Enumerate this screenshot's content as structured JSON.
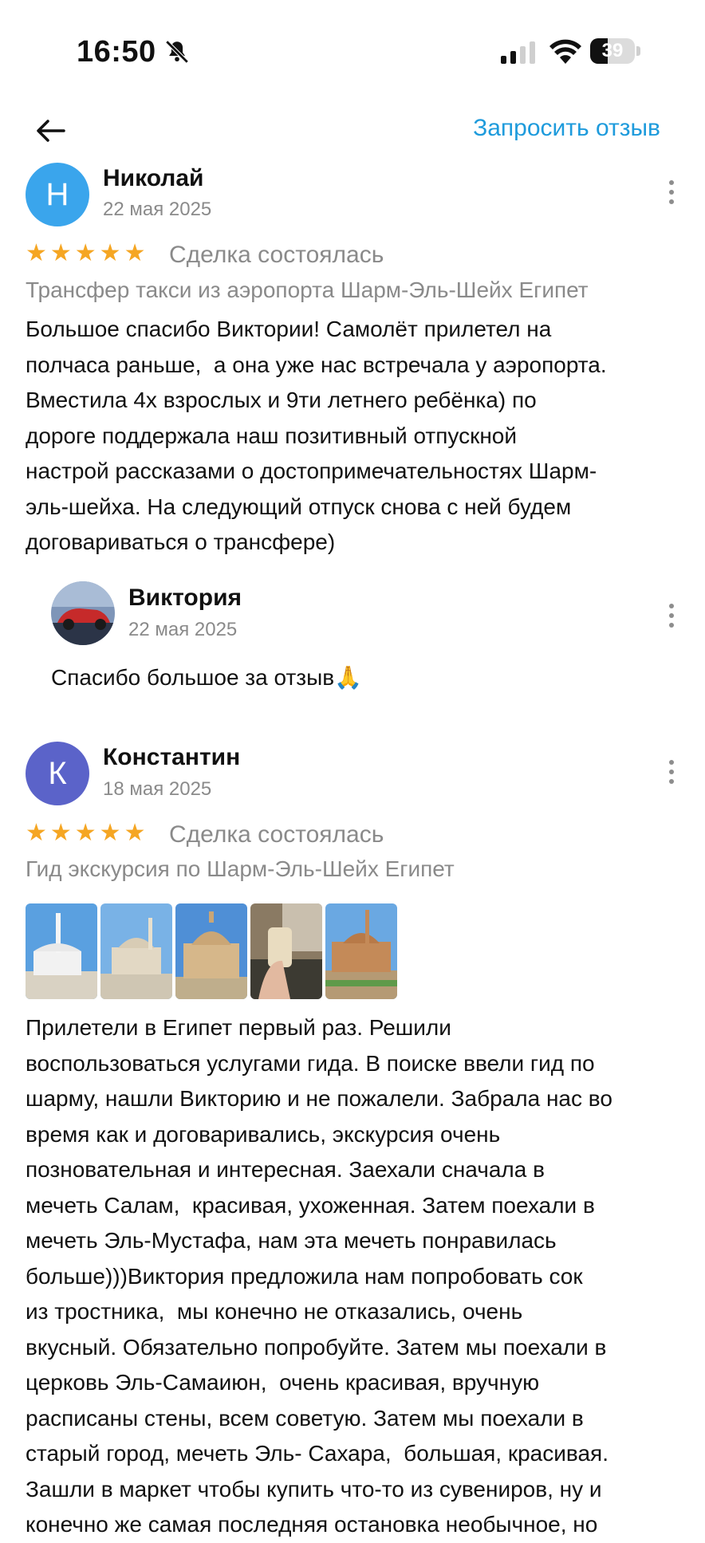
{
  "status_bar": {
    "time": "16:50",
    "battery_level": "39",
    "battery_fraction": 0.39,
    "icons": [
      "bell-muted-icon",
      "signal-icon",
      "wifi-icon",
      "battery-icon"
    ]
  },
  "header": {
    "request_review_label": "Запросить отзыв",
    "accent_color": "#1e9bdc"
  },
  "reviews": [
    {
      "avatar_letter": "Н",
      "avatar_color": "#3aa5ec",
      "name": "Николай",
      "date": "22 мая 2025",
      "rating": 5,
      "stars": "★★★★★",
      "deal_status": "Сделка состоялась",
      "service": "Трансфер такси из аэропорта Шарм-Эль-Шейх Египет",
      "text": "Большое спасибо Виктории! Самолёт прилетел на полчаса раньше,  а она уже нас встречала у аэропорта. Вместила 4х взрослых и 9ти летнего ребёнка) по дороге поддержала наш позитивный отпускной настрой рассказами о достопримечательностях Шарм-эль-шейха. На следующий отпуск снова с ней будем договариваться о трансфере)",
      "lines": [
        "Большое спасибо Виктории! Самолёт прилетел на",
        "полчаса раньше,  а она уже нас встречала у аэропорта.",
        "Вместила 4х взрослых и 9ти летнего ребёнка) по",
        "дороге поддержала наш позитивный отпускной",
        "настрой рассказами о достопримечательностях Шарм-",
        "эль-шейха. На следующий отпуск снова с ней будем",
        "договариваться о трансфере)"
      ],
      "reply": {
        "name": "Виктория",
        "date": "22 мая 2025",
        "text": "Спасибо большое за отзыв🙏"
      }
    },
    {
      "avatar_letter": "К",
      "avatar_color": "#5b63c9",
      "name": "Константин",
      "date": "18 мая 2025",
      "rating": 5,
      "stars": "★★★★★",
      "deal_status": "Сделка состоялась",
      "service": "Гид экскурсия по Шарм-Эль-Шейх Египет",
      "photo_count": 5,
      "text": "Прилетели в Египет первый раз. Решили воспользоваться услугами гида. В поиске ввели гид по шарму, нашли Викторию и не пожалели. Забрала нас во время как и договаривались, экскурсия очень позновательная и интересная. Заехали сначала в мечеть Салам,  красивая, ухоженная. Затем поехали в мечеть Эль-Мустафа, нам эта мечеть понравилась больше)))Виктория предложила нам попробовать сок из тростника,  мы конечно не отказались, очень вкусный. Обязательно попробуйте. Затем мы поехали в церковь Эль-Самаиюн,  очень красивая, вручную расписаны стены, всем советую. Затем мы поехали в старый город, мечеть Эль- Сахара,  большая, красивая. Зашли в маркет чтобы купить что-то из сувениров, ну и конечно же самая последняя остановка необычное, но",
      "lines": [
        "Прилетели в Египет первый раз. Решили",
        "воспользоваться услугами гида. В поиске ввели гид по",
        "шарму, нашли Викторию и не пожалели. Забрала нас во",
        "время как и договаривались, экскурсия очень",
        "позновательная и интересная. Заехали сначала в",
        "мечеть Салам,  красивая, ухоженная. Затем поехали в",
        "мечеть Эль-Мустафа, нам эта мечеть понравилась",
        "больше)))Виктория предложила нам попробовать сок",
        "из тростника,  мы конечно не отказались, очень",
        "вкусный. Обязательно попробуйте. Затем мы поехали в",
        "церковь Эль-Самаиюн,  очень красивая, вручную",
        "расписаны стены, всем советую. Затем мы поехали в",
        "старый город, мечеть Эль- Сахара,  большая, красивая.",
        "Зашли в маркет чтобы купить что-то из сувениров, ну и",
        "конечно же самая последняя остановка необычное, но"
      ]
    }
  ]
}
